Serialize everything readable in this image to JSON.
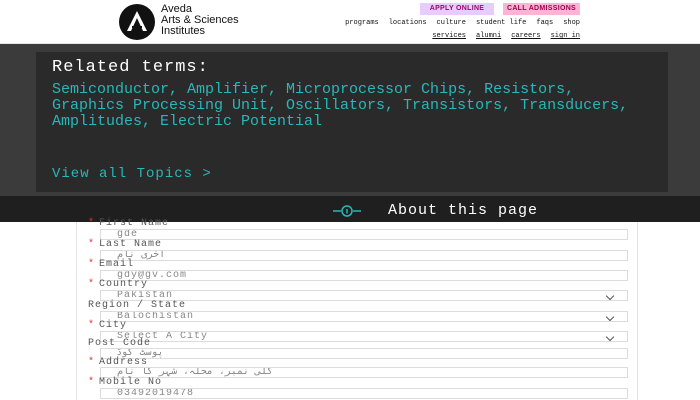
{
  "brand": {
    "line1": "Aveda",
    "line2": "Arts & Sciences",
    "line3": "Institutes",
    "logo_icon": "aveda-logo-icon"
  },
  "header": {
    "apply_label": "APPLY ONLINE",
    "call_label": "CALL ADMISSIONS",
    "nav_primary": [
      "programs",
      "locations",
      "culture",
      "student life",
      "faqs",
      "shop"
    ],
    "nav_secondary": [
      "services",
      "alumni",
      "careers",
      "sign in"
    ]
  },
  "related": {
    "title": "Related terms:",
    "terms": "Semiconductor, Amplifier, Microprocessor Chips, Resistors, Graphics Processing Unit, Oscillators, Transistors, Transducers, Amplitudes, Electric Potential",
    "view_all": "View all Topics  >",
    "about": "About this page",
    "about_icon": "info-circle-icon"
  },
  "form": {
    "fields": [
      {
        "label": "First Name",
        "value": "gde",
        "required": true
      },
      {
        "label": "Last Name",
        "value": "اخری نام",
        "required": true
      },
      {
        "label": "Email",
        "value": "gdy@gv.com",
        "required": true
      },
      {
        "label": "Country",
        "value": "Pakistan",
        "required": true
      },
      {
        "label": "Region / State",
        "value": "Balochistan",
        "required": false
      },
      {
        "label": "City",
        "value": "Select A City",
        "required": true
      },
      {
        "label": "Post Code",
        "value": "پوسٹ کوڈ",
        "required": false
      },
      {
        "label": "Address",
        "value": "گلی نمبر، محلہ، شہر کا نام",
        "required": true
      },
      {
        "label": "Mobile No",
        "value": "03492019478",
        "required": true
      }
    ]
  },
  "colors": {
    "accent_teal": "#27b8b8",
    "apply_bg": "#e7ccff",
    "call_bg": "#ffb4d3",
    "dark_bg": "#2a2a2a"
  }
}
